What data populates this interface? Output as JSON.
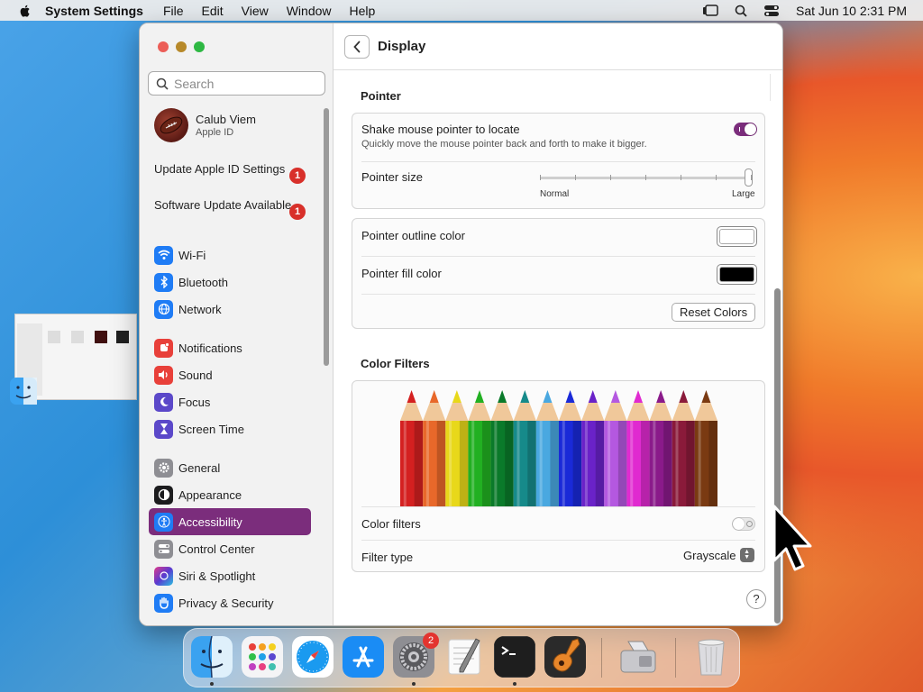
{
  "menubar": {
    "app_name": "System Settings",
    "items": [
      "File",
      "Edit",
      "View",
      "Window",
      "Help"
    ],
    "datetime": "Sat Jun 10  2:31 PM"
  },
  "sidebar": {
    "search_placeholder": "Search",
    "profile": {
      "name": "Calub Viem",
      "subtitle": "Apple ID"
    },
    "notices": [
      {
        "label": "Update Apple ID Settings",
        "badge": "1"
      },
      {
        "label": "Software Update Available",
        "badge": "1"
      }
    ],
    "items": [
      {
        "label": "Wi-Fi",
        "icon": "wifi-icon",
        "color": "#1f7cf5"
      },
      {
        "label": "Bluetooth",
        "icon": "bluetooth-icon",
        "color": "#1f7cf5"
      },
      {
        "label": "Network",
        "icon": "globe-icon",
        "color": "#1f7cf5"
      },
      {
        "label": "Notifications",
        "icon": "bell-icon",
        "color": "#e8403a"
      },
      {
        "label": "Sound",
        "icon": "speaker-icon",
        "color": "#e8403a"
      },
      {
        "label": "Focus",
        "icon": "moon-icon",
        "color": "#5b48c9"
      },
      {
        "label": "Screen Time",
        "icon": "hourglass-icon",
        "color": "#5b48c9"
      },
      {
        "label": "General",
        "icon": "gear-icon",
        "color": "#8e8e93"
      },
      {
        "label": "Appearance",
        "icon": "appearance-icon",
        "color": "#1c1c1e"
      },
      {
        "label": "Accessibility",
        "icon": "accessibility-icon",
        "color": "#1f7cf5",
        "active": true
      },
      {
        "label": "Control Center",
        "icon": "control-center-icon",
        "color": "#8e8e93"
      },
      {
        "label": "Siri & Spotlight",
        "icon": "siri-icon",
        "color": "#2b2b6b"
      },
      {
        "label": "Privacy & Security",
        "icon": "hand-icon",
        "color": "#1f7cf5"
      }
    ]
  },
  "content": {
    "title": "Display",
    "pointer": {
      "section_title": "Pointer",
      "shake_label": "Shake mouse pointer to locate",
      "shake_desc": "Quickly move the mouse pointer back and forth to make it bigger.",
      "shake_on": true,
      "size_label": "Pointer size",
      "size_min_label": "Normal",
      "size_max_label": "Large",
      "size_value": 1.0,
      "outline_label": "Pointer outline color",
      "outline_color": "#ffffff",
      "fill_label": "Pointer fill color",
      "fill_color": "#000000",
      "reset_label": "Reset Colors"
    },
    "color_filters": {
      "section_title": "Color Filters",
      "pencil_colors": [
        "#d42020",
        "#e8682a",
        "#e8d81a",
        "#22b022",
        "#0a7a2a",
        "#168a8a",
        "#4aa8e0",
        "#1a2ad8",
        "#6a22c8",
        "#b458e0",
        "#e02ad0",
        "#8a1a8a",
        "#8a1a3a",
        "#7a3a12"
      ],
      "filters_label": "Color filters",
      "filters_on": false,
      "filter_type_label": "Filter type",
      "filter_type_value": "Grayscale"
    },
    "help_label": "?"
  },
  "dock": {
    "apps": [
      "finder-icon",
      "launchpad-icon",
      "safari-icon",
      "app-store-icon",
      "system-settings-icon",
      "textedit-icon",
      "terminal-icon",
      "garageband-icon",
      "migration-icon",
      "trash-icon"
    ],
    "settings_badge": "2"
  }
}
